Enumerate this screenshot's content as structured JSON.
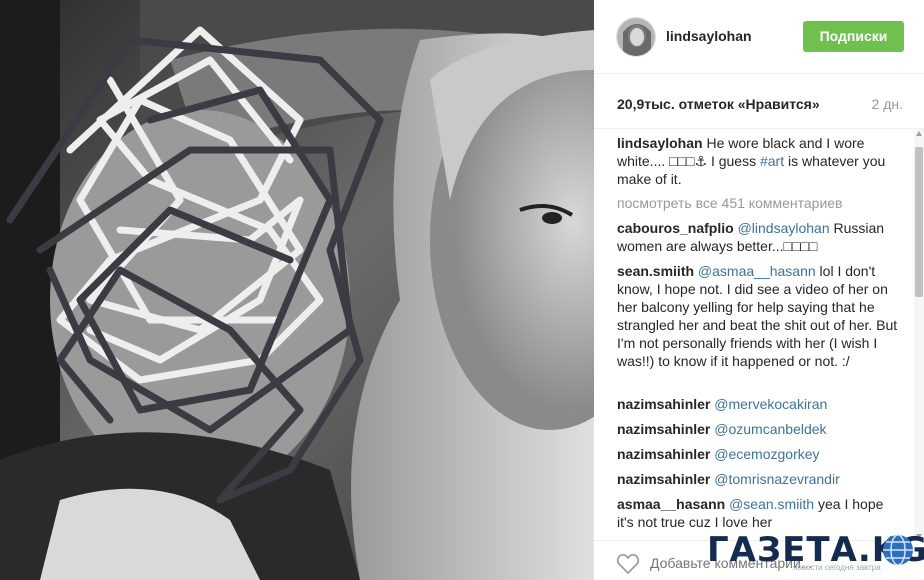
{
  "post": {
    "username": "lindsaylohan",
    "follow_label": "Подписки",
    "likes_text": "20,9тыс. отметок «Нравится»",
    "time_ago": "2 дн."
  },
  "caption": {
    "user": "lindsaylohan",
    "text_1": "He wore black and I wore white.... ",
    "emoji": "□□□⚓",
    "text_2": " I guess ",
    "hashtag": "#art",
    "text_3": " is whatever you make of it."
  },
  "view_all_text": "посмотреть все 451 комментариев",
  "comments": [
    {
      "user": "cabouros_nafplio",
      "mention": "@lindsaylohan",
      "text": " Russian women are always better...□□□□"
    },
    {
      "user": "sean.smiith",
      "mention": "@asmaa__hasann",
      "text": " lol I don't know, I hope not. I did see a video of her on her balcony yelling for help saying that he strangled her and beat the shit out of her. But I'm not personally friends with her (I wish I was!!) to know if it happened or not. :/"
    },
    {
      "user": "nazimsahinler",
      "mention": "@mervekocakiran",
      "text": ""
    },
    {
      "user": "nazimsahinler",
      "mention": "@ozumcanbeldek",
      "text": ""
    },
    {
      "user": "nazimsahinler",
      "mention": "@ecemozgorkey",
      "text": ""
    },
    {
      "user": "nazimsahinler",
      "mention": "@tomrisnazevrandir",
      "text": ""
    },
    {
      "user": "asmaa__hasann",
      "mention": "@sean.smiith",
      "text": " yea I hope it's not true cuz I love her"
    }
  ],
  "comment_placeholder": "Добавьте комментарий...",
  "watermark": {
    "logo_text": "ГАЗЕТА.KG",
    "tagline": "новости сегодня завтра"
  },
  "icons": {
    "like": "heart-outline-icon",
    "globe": "globe-icon"
  },
  "colors": {
    "follow_button": "#70c050",
    "mention": "#3f729b",
    "watermark": "#142a4f"
  }
}
